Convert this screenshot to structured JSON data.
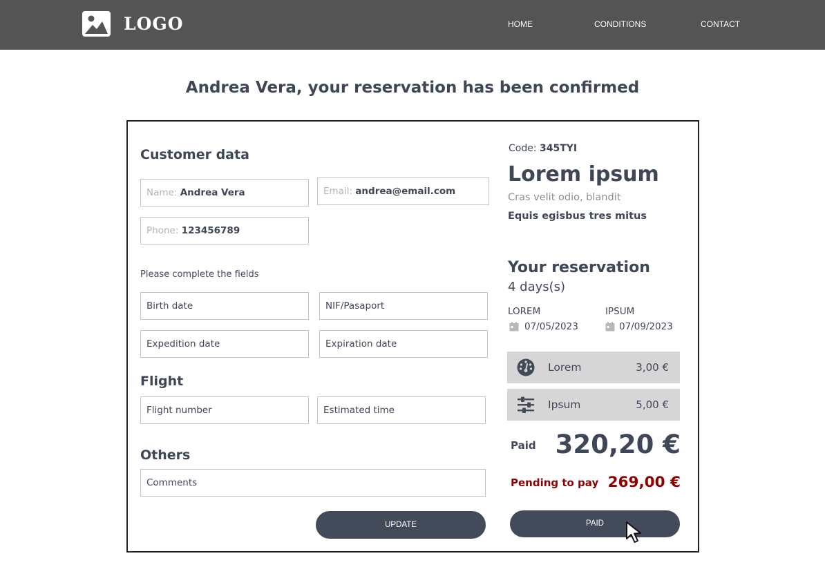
{
  "header": {
    "logo_text": "LOGO",
    "nav": {
      "home": "HOME",
      "conditions": "CONDITIONS",
      "contact": "CONTACT"
    }
  },
  "page_title": "Andrea Vera, your reservation has been confirmed",
  "customer": {
    "heading": "Customer data",
    "name_label": "Name:",
    "name_value": "Andrea Vera",
    "email_label": "Email:",
    "email_value": "andrea@email.com",
    "phone_label": "Phone:",
    "phone_value": "123456789"
  },
  "complete_note": "Please complete the fields",
  "fields": {
    "birth_date": "Birth date",
    "nif": "NIF/Pasaport",
    "expedition_date": "Expedition date",
    "expiration_date": "Expiration date"
  },
  "flight": {
    "heading": "Flight",
    "flight_number": "Flight number",
    "estimated_time": "Estimated time"
  },
  "others": {
    "heading": "Others",
    "comments": "Comments"
  },
  "buttons": {
    "update": "UPDATE",
    "paid": "PAID"
  },
  "summary": {
    "code_label": "Code:",
    "code_value": "345TYI",
    "title": "Lorem ipsum",
    "subtitle": "Cras velit odio,  blandit",
    "subtitle_bold": "Equis egisbus tres mitus",
    "reservation_heading": "Your reservation",
    "days": "4 days(s)",
    "start_label": "LOREM",
    "start_date": "07/05/2023",
    "end_label": "IPSUM",
    "end_date": "07/09/2023",
    "extras": [
      {
        "icon": "gauge-icon",
        "name": "Lorem",
        "price": "3,00 €"
      },
      {
        "icon": "sliders-icon",
        "name": "Ipsum",
        "price": "5,00 €"
      }
    ],
    "paid_label": "Paid",
    "paid_amount": "320,20 €",
    "pending_label": "Pending to pay",
    "pending_amount": "269,00 €"
  },
  "colors": {
    "header_bg": "#545454",
    "text": "#3f4757",
    "button_bg": "#434b5a",
    "extra_bg": "#d6d6d6",
    "pending": "#8b0000"
  }
}
